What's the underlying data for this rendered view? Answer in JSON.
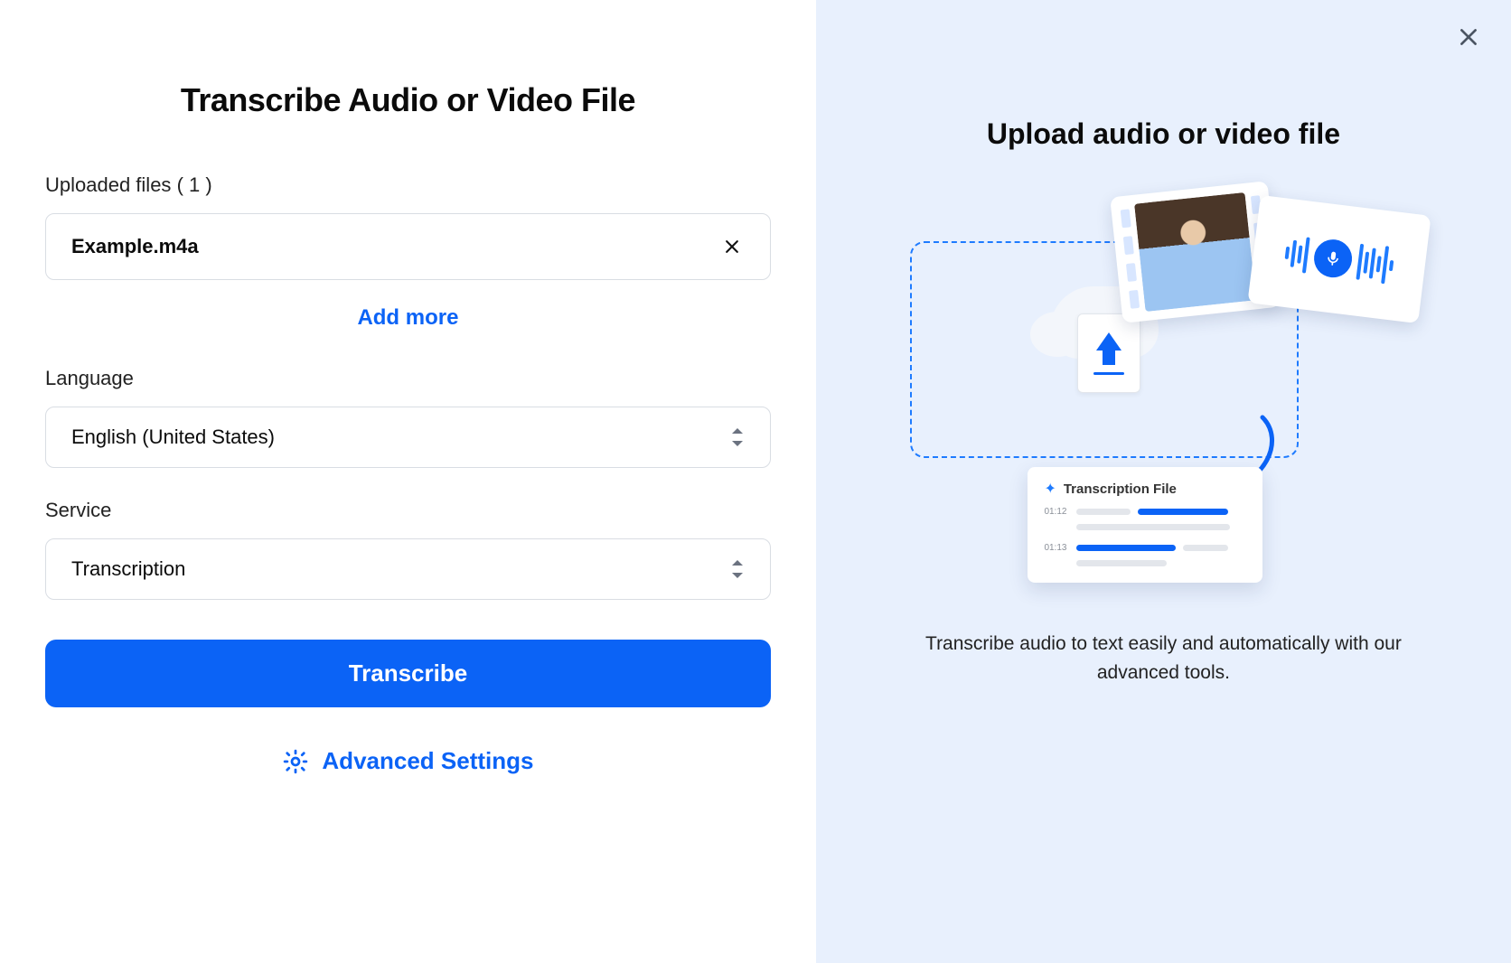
{
  "left": {
    "title": "Transcribe Audio or Video File",
    "uploaded_label_prefix": "Uploaded files",
    "uploaded_count_display": "( 1 )",
    "files": [
      {
        "name": "Example.m4a"
      }
    ],
    "add_more_label": "Add more",
    "language_label": "Language",
    "language_value": "English (United States)",
    "service_label": "Service",
    "service_value": "Transcription",
    "transcribe_button": "Transcribe",
    "advanced_label": "Advanced Settings"
  },
  "right": {
    "title": "Upload audio or video file",
    "description": "Transcribe audio to text easily and automatically with our advanced tools.",
    "illustration": {
      "transcription_card_title": "Transcription File",
      "timestamps": [
        "01:12",
        "01:13"
      ]
    }
  }
}
